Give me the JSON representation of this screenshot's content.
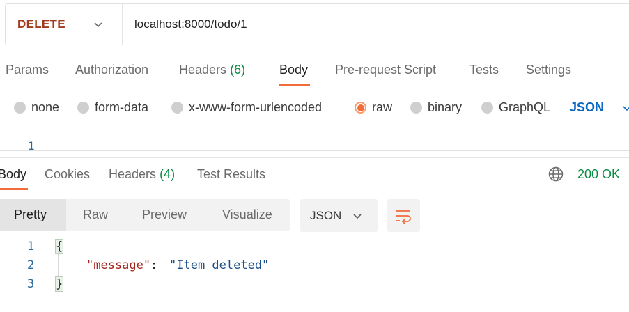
{
  "request": {
    "method": "DELETE",
    "url": "localhost:8000/todo/1"
  },
  "request_tabs": [
    {
      "label": "Params"
    },
    {
      "label": "Authorization"
    },
    {
      "label": "Headers",
      "count": "(6)"
    },
    {
      "label": "Body"
    },
    {
      "label": "Pre-request Script"
    },
    {
      "label": "Tests"
    },
    {
      "label": "Settings"
    }
  ],
  "body_types": [
    {
      "label": "none"
    },
    {
      "label": "form-data"
    },
    {
      "label": "x-www-form-urlencoded"
    },
    {
      "label": "raw"
    },
    {
      "label": "binary"
    },
    {
      "label": "GraphQL"
    }
  ],
  "raw_language": "JSON",
  "editor": {
    "line_number": "1"
  },
  "response_tabs": [
    {
      "label": "Body"
    },
    {
      "label": "Cookies"
    },
    {
      "label": "Headers",
      "count": "(4)"
    },
    {
      "label": "Test Results"
    }
  ],
  "response_status": "200 OK",
  "view_modes": [
    {
      "label": "Pretty"
    },
    {
      "label": "Raw"
    },
    {
      "label": "Preview"
    },
    {
      "label": "Visualize"
    }
  ],
  "response_format": "JSON",
  "response_body": {
    "line_numbers": [
      "1",
      "2",
      "3"
    ],
    "open_brace": "{",
    "key": "\"message\"",
    "colon": ": ",
    "value": "\"Item deleted\"",
    "close_brace": "}"
  },
  "colors": {
    "method": "#a13a1c",
    "accent": "#f26b3a",
    "count": "#0a8a43",
    "status": "#0a8a43",
    "language": "#0b68c4",
    "json_key": "#a5251e",
    "json_value": "#1b4f87"
  },
  "icons": {
    "method_dropdown": "chevron-down-icon",
    "language_dropdown": "chevron-down-icon",
    "network": "globe-icon",
    "format_dropdown": "chevron-down-icon",
    "wrap": "wrap-lines-icon"
  }
}
